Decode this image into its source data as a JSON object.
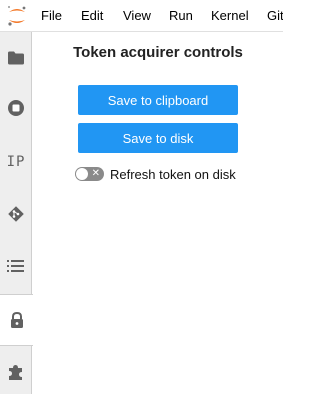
{
  "menubar": {
    "logo_icon": "jupyter-logo-icon",
    "items": [
      "File",
      "Edit",
      "View",
      "Run",
      "Kernel",
      "Git"
    ]
  },
  "sidebar": {
    "items": [
      {
        "icon": "folder-icon"
      },
      {
        "icon": "stop-circle-icon"
      },
      {
        "icon": "ip-text-icon",
        "label": "IP"
      },
      {
        "icon": "git-icon"
      },
      {
        "icon": "list-icon"
      },
      {
        "icon": "lock-icon",
        "active": true
      },
      {
        "icon": "puzzle-icon"
      }
    ]
  },
  "panel": {
    "title": "Token acquirer controls",
    "save_clipboard_label": "Save to clipboard",
    "save_disk_label": "Save to disk",
    "refresh_toggle_label": "Refresh token on disk",
    "refresh_toggle_on": false
  },
  "colors": {
    "accent": "#2196f3",
    "sidebar_bg": "#eeeeee",
    "icon": "#616161",
    "jupyter_orange": "#f37726"
  }
}
